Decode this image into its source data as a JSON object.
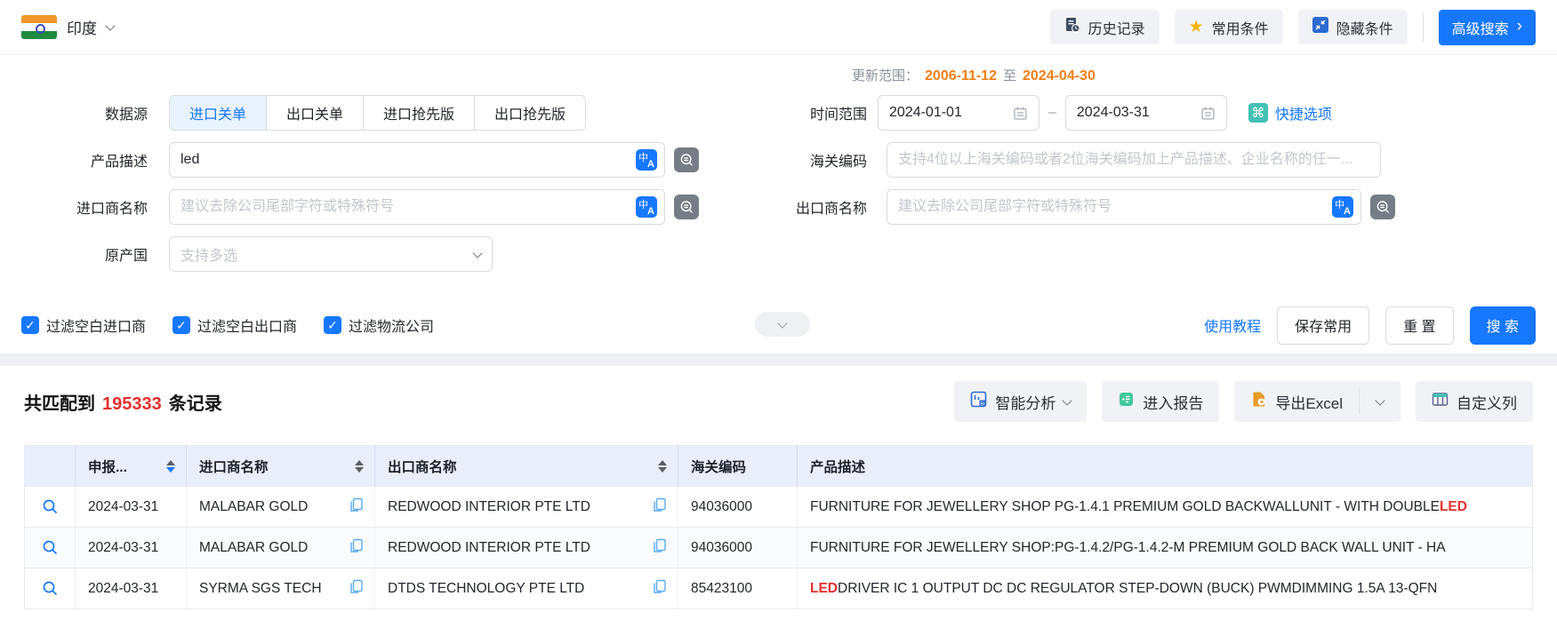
{
  "colors": {
    "primary": "#1677ff",
    "orange": "#f07f16",
    "red": "#e33030",
    "teal": "#45c0b4"
  },
  "topbar": {
    "country": "印度",
    "history": "历史记录",
    "favorites": "常用条件",
    "hide": "隐藏条件",
    "advanced": "高级搜索",
    "advanced_arrow": "›"
  },
  "form": {
    "update_label": "更新范围：",
    "update_from": "2006-11-12",
    "update_to_word": "至",
    "update_to": "2024-04-30",
    "data_source_label": "数据源",
    "tabs": [
      {
        "label": "进口关单",
        "active": true
      },
      {
        "label": "出口关单",
        "active": false
      },
      {
        "label": "进口抢先版",
        "active": false
      },
      {
        "label": "出口抢先版",
        "active": false
      }
    ],
    "time_label": "时间范围",
    "date_start": "2024-01-01",
    "date_end": "2024-03-31",
    "date_separator": "–",
    "quick_label": "快捷选项",
    "quick_glyph": "⌘",
    "product_label": "产品描述",
    "product_value": "led",
    "hs_label": "海关编码",
    "hs_placeholder": "支持4位以上海关编码或者2位海关编码加上产品描述、企业名称的任一...",
    "importer_label": "进口商名称",
    "importer_placeholder": "建议去除公司尾部字符或特殊符号",
    "exporter_label": "出口商名称",
    "exporter_placeholder": "建议去除公司尾部字符或特殊符号",
    "origin_label": "原产国",
    "origin_placeholder": "支持多选",
    "checkboxes": [
      {
        "label": "过滤空白进口商",
        "checked": true
      },
      {
        "label": "过滤空白出口商",
        "checked": true
      },
      {
        "label": "过滤物流公司",
        "checked": true
      }
    ],
    "check_glyph": "✓",
    "tutorial": "使用教程",
    "save": "保存常用",
    "reset": "重 置",
    "search": "搜 索"
  },
  "results": {
    "match_prefix": "共匹配到",
    "match_count": "195333",
    "match_suffix": "条记录",
    "toolbar": {
      "analysis": "智能分析",
      "report": "进入报告",
      "export": "导出Excel",
      "columns": "自定义列"
    },
    "table": {
      "headers": {
        "date": "申报...",
        "importer": "进口商名称",
        "exporter": "出口商名称",
        "hs": "海关编码",
        "desc": "产品描述"
      },
      "sort": {
        "date": "desc",
        "importer": "none",
        "exporter": "none"
      },
      "rows": [
        {
          "date": "2024-03-31",
          "importer": "MALABAR GOLD",
          "exporter": "REDWOOD INTERIOR PTE LTD",
          "hs": "94036000",
          "desc_parts": [
            {
              "text": "FURNITURE FOR JEWELLERY SHOP PG-1.4.1 PREMIUM GOLD BACKWALLUNIT - WITH DOUBLE ",
              "hl": false
            },
            {
              "text": "LED",
              "hl": true
            }
          ]
        },
        {
          "date": "2024-03-31",
          "importer": "MALABAR GOLD",
          "exporter": "REDWOOD INTERIOR PTE LTD",
          "hs": "94036000",
          "desc_parts": [
            {
              "text": "FURNITURE FOR JEWELLERY SHOP:PG-1.4.2/PG-1.4.2-M PREMIUM GOLD BACK WALL UNIT - HA",
              "hl": false
            }
          ]
        },
        {
          "date": "2024-03-31",
          "importer": "SYRMA SGS TECH",
          "exporter": "DTDS TECHNOLOGY PTE LTD",
          "hs": "85423100",
          "desc_parts": [
            {
              "text": "LED",
              "hl": true
            },
            {
              "text": " DRIVER IC 1 OUTPUT DC DC REGULATOR STEP-DOWN (BUCK) PWMDIMMING 1.5A 13-QFN",
              "hl": false
            }
          ]
        }
      ]
    }
  }
}
